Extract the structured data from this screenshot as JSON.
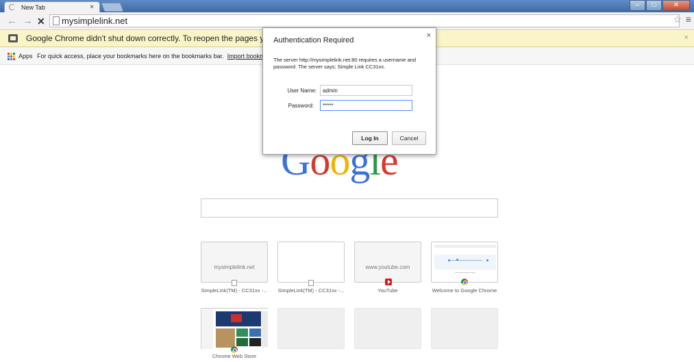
{
  "window": {
    "tab_title": "New Tab",
    "tab_close": "×",
    "minimize": "–",
    "maximize": "□",
    "close": "✕"
  },
  "toolbar": {
    "back": "←",
    "forward": "→",
    "stop": "✕",
    "url": "mysimplelink.net",
    "star": "☆",
    "menu": "≡"
  },
  "infobar": {
    "message": "Google Chrome didn't shut down correctly. To reopen the pages you had o",
    "close": "×"
  },
  "bookmarks": {
    "apps_label": "Apps",
    "hint": "For quick access, place your bookmarks here on the bookmarks bar.",
    "import_link": "Import bookmarks n",
    "apps_colors": [
      "#db4437",
      "#f4c20d",
      "#0f9d58",
      "#4285f4",
      "#db4437",
      "#f4c20d",
      "#0f9d58",
      "#4285f4",
      "#db4437"
    ]
  },
  "logo": {
    "letters": [
      {
        "ch": "G",
        "color": "#3b72e0"
      },
      {
        "ch": "o",
        "color": "#d8392b"
      },
      {
        "ch": "o",
        "color": "#f0b400"
      },
      {
        "ch": "g",
        "color": "#3b72e0"
      },
      {
        "ch": "l",
        "color": "#2a9a45"
      },
      {
        "ch": "e",
        "color": "#d8392b"
      }
    ]
  },
  "tiles": [
    {
      "thumb_text": "mysimplelink.net",
      "caption": "SimpleLink(TM) - CC31xx -...",
      "favicon": "page-icon"
    },
    {
      "thumb_text": "",
      "caption": "SimpleLink(TM) - CC31xx -...",
      "favicon": "page-icon"
    },
    {
      "thumb_text": "www.youtube.com",
      "caption": "YouTube",
      "favicon": "youtube-icon"
    },
    {
      "thumb_text": "",
      "caption": "Welcome to Google Chrome",
      "favicon": "chrome-icon"
    },
    {
      "thumb_text": "",
      "caption": "Chrome Web Store",
      "favicon": "chrome-icon"
    }
  ],
  "dialog": {
    "title": "Authentication Required",
    "close": "×",
    "message": "The server http://mysimplelink.net:80 requires a username and password. The server says: Simple Link CC31xx.",
    "username_label": "User Name:",
    "username_value": "admin",
    "password_label": "Password:",
    "password_value": "*****",
    "login_label": "Log In",
    "cancel_label": "Cancel"
  }
}
